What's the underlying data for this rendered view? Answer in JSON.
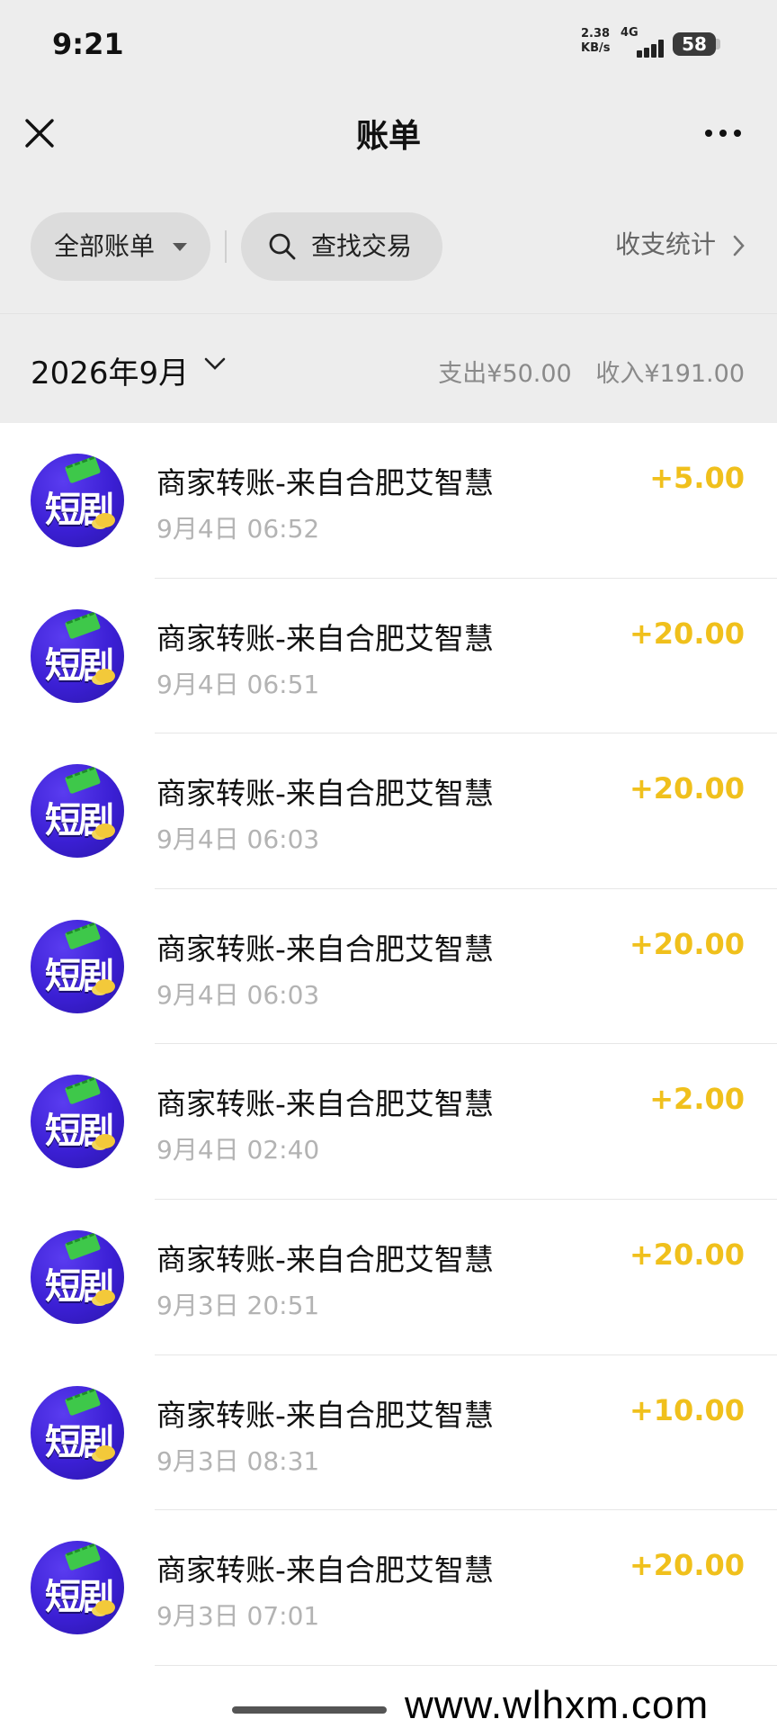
{
  "status_bar": {
    "time": "9:21",
    "net_speed": "2.38 KB/s",
    "net_type": "4G",
    "battery": "58"
  },
  "header": {
    "title": "账单",
    "close_icon": "close-icon",
    "more_icon": "more-icon"
  },
  "filters": {
    "all_bills": "全部账单",
    "search": "查找交易",
    "stats": "收支统计"
  },
  "month": {
    "label": "2026年9月",
    "expense": "支出¥50.00",
    "income": "收入¥191.00"
  },
  "colors": {
    "amount": "#f0c01c",
    "background": "#ededed"
  },
  "transactions": [
    {
      "title": "商家转账-来自合肥艾智慧",
      "time": "9月4日 06:52",
      "amount": "+5.00",
      "avatar_text": "短剧"
    },
    {
      "title": "商家转账-来自合肥艾智慧",
      "time": "9月4日 06:51",
      "amount": "+20.00",
      "avatar_text": "短剧"
    },
    {
      "title": "商家转账-来自合肥艾智慧",
      "time": "9月4日 06:03",
      "amount": "+20.00",
      "avatar_text": "短剧"
    },
    {
      "title": "商家转账-来自合肥艾智慧",
      "time": "9月4日 06:03",
      "amount": "+20.00",
      "avatar_text": "短剧"
    },
    {
      "title": "商家转账-来自合肥艾智慧",
      "time": "9月4日 02:40",
      "amount": "+2.00",
      "avatar_text": "短剧"
    },
    {
      "title": "商家转账-来自合肥艾智慧",
      "time": "9月3日 20:51",
      "amount": "+20.00",
      "avatar_text": "短剧"
    },
    {
      "title": "商家转账-来自合肥艾智慧",
      "time": "9月3日 08:31",
      "amount": "+10.00",
      "avatar_text": "短剧"
    },
    {
      "title": "商家转账-来自合肥艾智慧",
      "time": "9月3日 07:01",
      "amount": "+20.00",
      "avatar_text": "短剧"
    }
  ],
  "watermark": "www.wlhxm.com"
}
